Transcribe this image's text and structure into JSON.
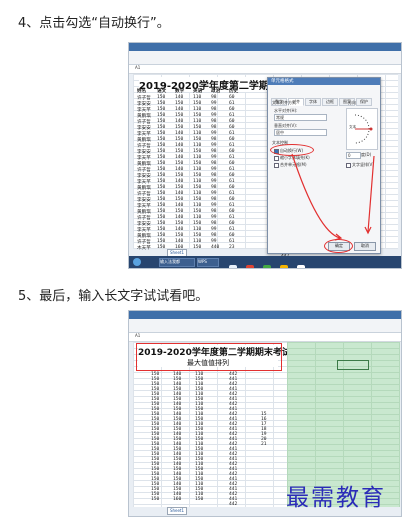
{
  "steps": {
    "step4": "4、点击勾选“自动换行”。",
    "step5": "5、最后，输入长文字试试看吧。"
  },
  "shot1": {
    "title_cell": "2019-2020学年度第二学期期末考试成绩",
    "headers": [
      "姓名",
      "语文",
      "数学",
      "英语",
      "政治",
      "历史"
    ],
    "rows": [
      [
        "许子哲",
        "150",
        "140",
        "110",
        "98",
        "60"
      ],
      [
        "李安安",
        "150",
        "150",
        "150",
        "99",
        "61"
      ],
      [
        "李天芊",
        "150",
        "140",
        "110",
        "98",
        "60"
      ],
      [
        "黄鹏琪",
        "150",
        "150",
        "150",
        "99",
        "61"
      ],
      [
        "许子哲",
        "150",
        "140",
        "110",
        "98",
        "60"
      ],
      [
        "李安安",
        "150",
        "150",
        "150",
        "98",
        "60"
      ],
      [
        "李天芊",
        "150",
        "140",
        "110",
        "99",
        "61"
      ],
      [
        "黄鹏琪",
        "150",
        "150",
        "150",
        "98",
        "60"
      ],
      [
        "许子哲",
        "150",
        "140",
        "110",
        "99",
        "61"
      ],
      [
        "李安安",
        "150",
        "150",
        "150",
        "98",
        "60"
      ],
      [
        "李天芊",
        "150",
        "140",
        "110",
        "99",
        "61"
      ],
      [
        "黄鹏琪",
        "150",
        "150",
        "150",
        "98",
        "60"
      ],
      [
        "许子哲",
        "150",
        "140",
        "110",
        "99",
        "61"
      ],
      [
        "李安安",
        "150",
        "150",
        "150",
        "98",
        "60"
      ],
      [
        "李天芊",
        "150",
        "140",
        "110",
        "99",
        "61"
      ],
      [
        "黄鹏琪",
        "150",
        "150",
        "150",
        "98",
        "60"
      ],
      [
        "许子哲",
        "150",
        "140",
        "110",
        "99",
        "61"
      ],
      [
        "李安安",
        "150",
        "150",
        "150",
        "98",
        "60"
      ],
      [
        "李天芊",
        "150",
        "140",
        "110",
        "99",
        "61"
      ],
      [
        "黄鹏琪",
        "150",
        "150",
        "150",
        "98",
        "60"
      ],
      [
        "许子哲",
        "150",
        "140",
        "110",
        "99",
        "61"
      ],
      [
        "李安安",
        "150",
        "150",
        "150",
        "98",
        "60"
      ],
      [
        "李天芊",
        "150",
        "140",
        "110",
        "99",
        "61"
      ],
      [
        "黄鹏琪",
        "150",
        "150",
        "150",
        "98",
        "60"
      ],
      [
        "许子哲",
        "150",
        "140",
        "110",
        "99",
        "61"
      ],
      [
        "木天芊",
        "150",
        "160",
        "150",
        "440",
        "23"
      ]
    ],
    "side_col": [
      "441",
      "442",
      "441",
      "442",
      "441",
      "442"
    ],
    "dialog": {
      "title": "单元格格式",
      "tabs": [
        "数字",
        "对齐",
        "字体",
        "边框",
        "图案",
        "保护"
      ],
      "section_align": "文本对齐方式",
      "h_label": "水平对齐(H):",
      "h_value": "常规",
      "v_label": "垂直对齐(V):",
      "v_value": "居中",
      "section_control": "文本控制",
      "wrap_label": "自动换行(W)",
      "shrink_label": "缩小字体填充(K)",
      "merge_label": "合并单元格(M)",
      "orient_label": "方向",
      "orient_text": "文本",
      "degree_value": "0",
      "degree_label": "度(D)",
      "vertical_text_label": "文字竖排(V)",
      "ok": "确定",
      "cancel": "取消"
    },
    "ribbon_items": [
      "开始",
      "插入",
      "页面布局",
      "公式",
      "数据",
      "审阅",
      "视图",
      "开发工具",
      "特色功能"
    ],
    "cell_ref": "A1",
    "sheet_tab": "Sheet1",
    "taskbar_items": [
      "输入法我都",
      "WPS"
    ]
  },
  "shot2": {
    "title_line1": "2019-2020学年度第二学期期末考试成绩",
    "title_line2": "最大值值排列",
    "ribbon_items": [
      "开始",
      "插入",
      "页面布局",
      "公式",
      "数据",
      "审阅",
      "视图",
      "开发工具",
      "特色功能"
    ],
    "cell_ref": "A1",
    "col_d": [
      "442",
      "441",
      "442",
      "441",
      "442",
      "441",
      "442",
      "441",
      "442",
      "441",
      "442",
      "441",
      "442",
      "441",
      "442",
      "441",
      "442",
      "441",
      "442",
      "441",
      "442",
      "441",
      "442",
      "441",
      "442",
      "441",
      "442"
    ],
    "col_e": [
      "",
      "",
      "",
      "",
      "",
      "",
      "",
      "",
      "15",
      "16",
      "17",
      "18",
      "19",
      "20",
      "21",
      "",
      "",
      "",
      "",
      "",
      "",
      "",
      "",
      "",
      "",
      "",
      ""
    ],
    "sheet_tab": "Sheet1"
  },
  "watermark": "最需教育",
  "colors": {
    "accent": "#3f6fa9",
    "highlight": "#e23030",
    "selection_green": "#c9e8cf"
  }
}
